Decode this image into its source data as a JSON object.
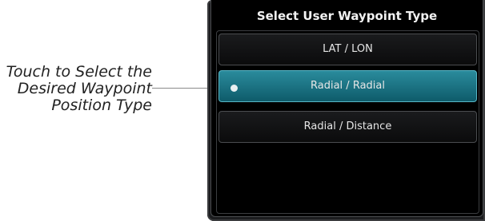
{
  "callout": {
    "line1": "Touch to Select the",
    "line2": "Desired Waypoint",
    "line3": "Position Type"
  },
  "dialog": {
    "title": "Select User Waypoint Type",
    "options": [
      {
        "label": "LAT / LON",
        "selected": false
      },
      {
        "label": "Radial / Radial",
        "selected": true
      },
      {
        "label": "Radial / Distance",
        "selected": false
      }
    ]
  },
  "colors": {
    "selected": "#1a7584",
    "background": "#000000",
    "text": "#e6e6e6"
  }
}
